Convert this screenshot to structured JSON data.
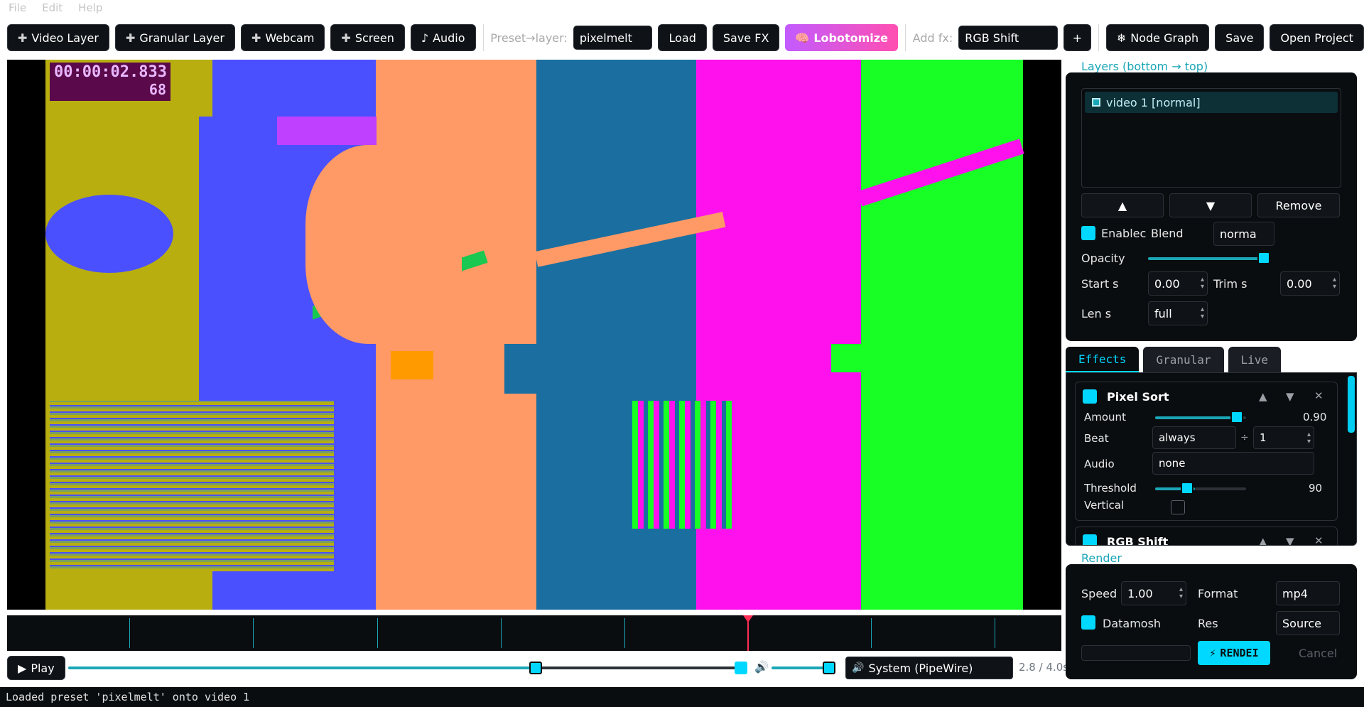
{
  "menu": [
    "File",
    "Edit",
    "Help"
  ],
  "toolbar": {
    "video_layer": "Video Layer",
    "granular_layer": "Granular Layer",
    "webcam": "Webcam",
    "screen": "Screen",
    "audio": "Audio",
    "preset_label": "Preset→layer:",
    "preset_value": "pixelmelt",
    "load": "Load",
    "save_fx": "Save FX",
    "lobotomize": "Lobotomize",
    "add_fx_label": "Add fx:",
    "add_fx_value": "RGB Shift",
    "add_plus": "+",
    "node_graph": "Node Graph",
    "save": "Save",
    "open_project": "Open Project"
  },
  "preview": {
    "osd_time": "00:00:02.833",
    "osd_frame": "68"
  },
  "transport": {
    "play": "Play",
    "audio_device": "System (PipeWire)",
    "time": "2.8 / 4.0s",
    "position": 0.7
  },
  "status": "Loaded preset 'pixelmelt' onto video 1",
  "layers": {
    "title": "Layers  (bottom → top)",
    "items": [
      "video 1  [normal]"
    ],
    "up": "▲",
    "down": "▼",
    "remove": "Remove",
    "enabled_label": "Enablec",
    "blend_label": "Blend",
    "blend_value": "norma",
    "opacity_label": "Opacity",
    "opacity": 0.96,
    "start_label": "Start s",
    "start_value": "0.00",
    "trim_label": "Trim s",
    "trim_value": "0.00",
    "len_label": "Len s",
    "len_value": "full"
  },
  "tabs": [
    "Effects",
    "Granular",
    "Live"
  ],
  "effects": [
    {
      "name": "Pixel Sort",
      "amount_label": "Amount",
      "amount": "0.90",
      "amount_level": 0.9,
      "beat_label": "Beat",
      "beat_value": "always",
      "beat_div": "1",
      "audio_label": "Audio",
      "audio_value": "none",
      "threshold_label": "Threshold",
      "threshold": "90",
      "threshold_level": 0.35,
      "vertical_label": "Vertical"
    },
    {
      "name": "RGB Shift"
    }
  ],
  "render": {
    "title": "Render",
    "speed_label": "Speed",
    "speed_value": "1.00",
    "format_label": "Format",
    "format_value": "mp4",
    "datamosh_label": "Datamosh",
    "res_label": "Res",
    "res_value": "Source",
    "render_label": "RENDEI",
    "cancel_label": "Cancel"
  },
  "colors": {
    "accent": "#00d8ff",
    "panel_bg": "#0a0d10",
    "olive": "#b8ae10",
    "blue": "#4b50ff",
    "salmon": "#ff9966",
    "teal": "#1a6fa0",
    "magenta": "#ff11ee",
    "green": "#18ff25"
  }
}
